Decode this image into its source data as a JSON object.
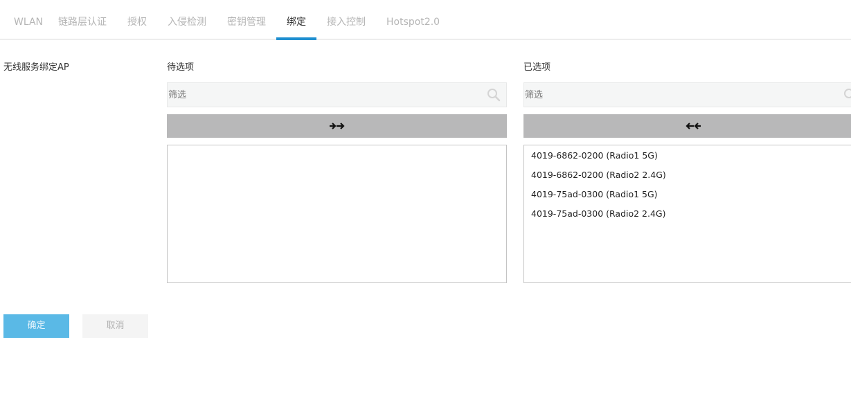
{
  "tabs": [
    {
      "label": "WLAN",
      "active": false
    },
    {
      "label": "链路层认证",
      "active": false
    },
    {
      "label": "授权",
      "active": false
    },
    {
      "label": "入侵检测",
      "active": false
    },
    {
      "label": "密钥管理",
      "active": false
    },
    {
      "label": "绑定",
      "active": true
    },
    {
      "label": "接入控制",
      "active": false
    },
    {
      "label": "Hotspot2.0",
      "active": false
    }
  ],
  "form": {
    "label": "无线服务绑定AP"
  },
  "available": {
    "title": "待选项",
    "filter_placeholder": "筛选",
    "move_icon": "double-arrow-right-icon",
    "items": []
  },
  "selected": {
    "title": "已选项",
    "filter_placeholder": "筛选",
    "move_icon": "double-arrow-left-icon",
    "items": [
      "4019-6862-0200 (Radio1 5G)",
      "4019-6862-0200 (Radio2 2.4G)",
      "4019-75ad-0300 (Radio1 5G)",
      "4019-75ad-0300 (Radio2 2.4G)"
    ]
  },
  "actions": {
    "ok_label": "确定",
    "cancel_label": "取消"
  },
  "colors": {
    "accent": "#1e8fd0",
    "ok_button": "#5ab9e6",
    "move_button": "#b8b8b9"
  }
}
